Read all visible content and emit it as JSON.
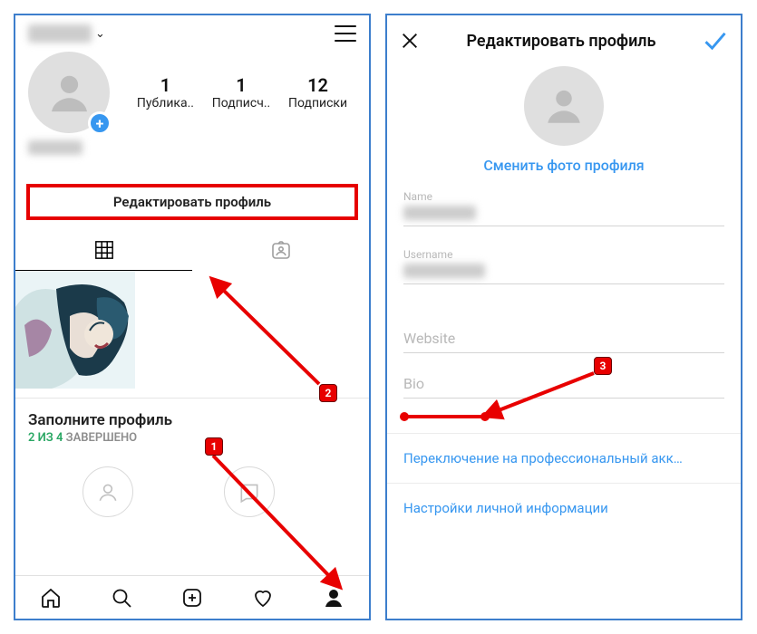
{
  "profile": {
    "stats": {
      "posts": {
        "count": "1",
        "label": "Публика.."
      },
      "followers": {
        "count": "1",
        "label": "Подписч.."
      },
      "following": {
        "count": "12",
        "label": "Подписки"
      }
    },
    "edit_button": "Редактировать профиль",
    "card": {
      "title": "Заполните профиль",
      "progress_done": "2 ИЗ 4",
      "progress_rest": " ЗАВЕРШЕНО"
    }
  },
  "edit": {
    "title": "Редактировать профиль",
    "change_photo": "Сменить фото профиля",
    "fields": {
      "name_label": "Name",
      "username_label": "Username",
      "website_placeholder": "Website",
      "bio_placeholder": "Bio"
    },
    "links": {
      "switch_pro": "Переключение на профессиональный акк…",
      "personal_settings": "Настройки личной информации"
    }
  },
  "markers": {
    "m1": "1",
    "m2": "2",
    "m3": "3"
  }
}
